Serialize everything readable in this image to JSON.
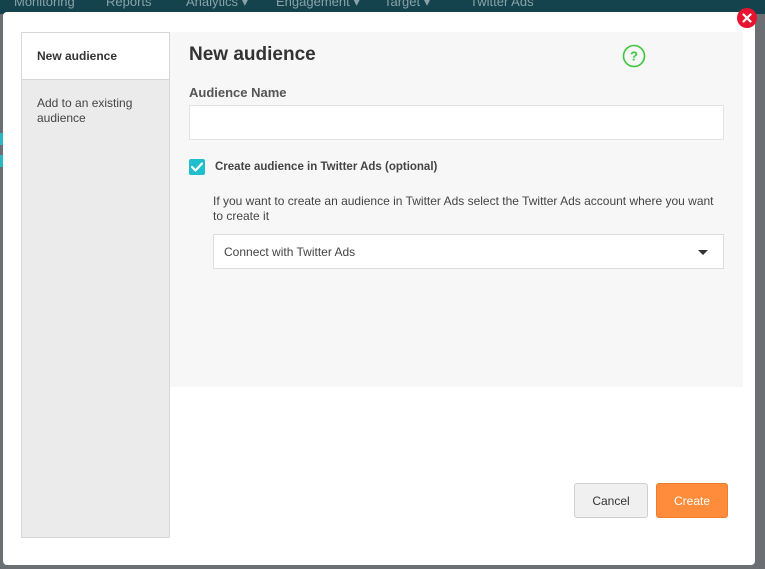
{
  "background_nav": [
    "Monitoring",
    "Reports",
    "Analytics ▾",
    "Engagement ▾",
    "Target ▾",
    "Twitter Ads"
  ],
  "modal": {
    "close_icon": "close-icon",
    "sidebar": {
      "tabs": [
        {
          "label": "New audience",
          "active": true
        },
        {
          "label": "Add to an existing audience",
          "active": false
        }
      ]
    },
    "content": {
      "title": "New audience",
      "help_icon": "question-circle-icon",
      "audience_name_label": "Audience Name",
      "audience_name_value": "",
      "twitter_ads_checkbox": {
        "checked": true,
        "label": "Create audience in Twitter Ads (optional)"
      },
      "help_text": "If you want to create an audience in Twitter Ads select the Twitter Ads account where you want to create it",
      "account_select": {
        "selected": "Connect with Twitter Ads"
      }
    },
    "buttons": {
      "cancel": "Cancel",
      "create": "Create"
    }
  },
  "colors": {
    "accent_teal": "#1fbfce",
    "create_orange": "#ff8c3a",
    "close_red": "#e8132f",
    "help_green": "#3ec43e"
  }
}
